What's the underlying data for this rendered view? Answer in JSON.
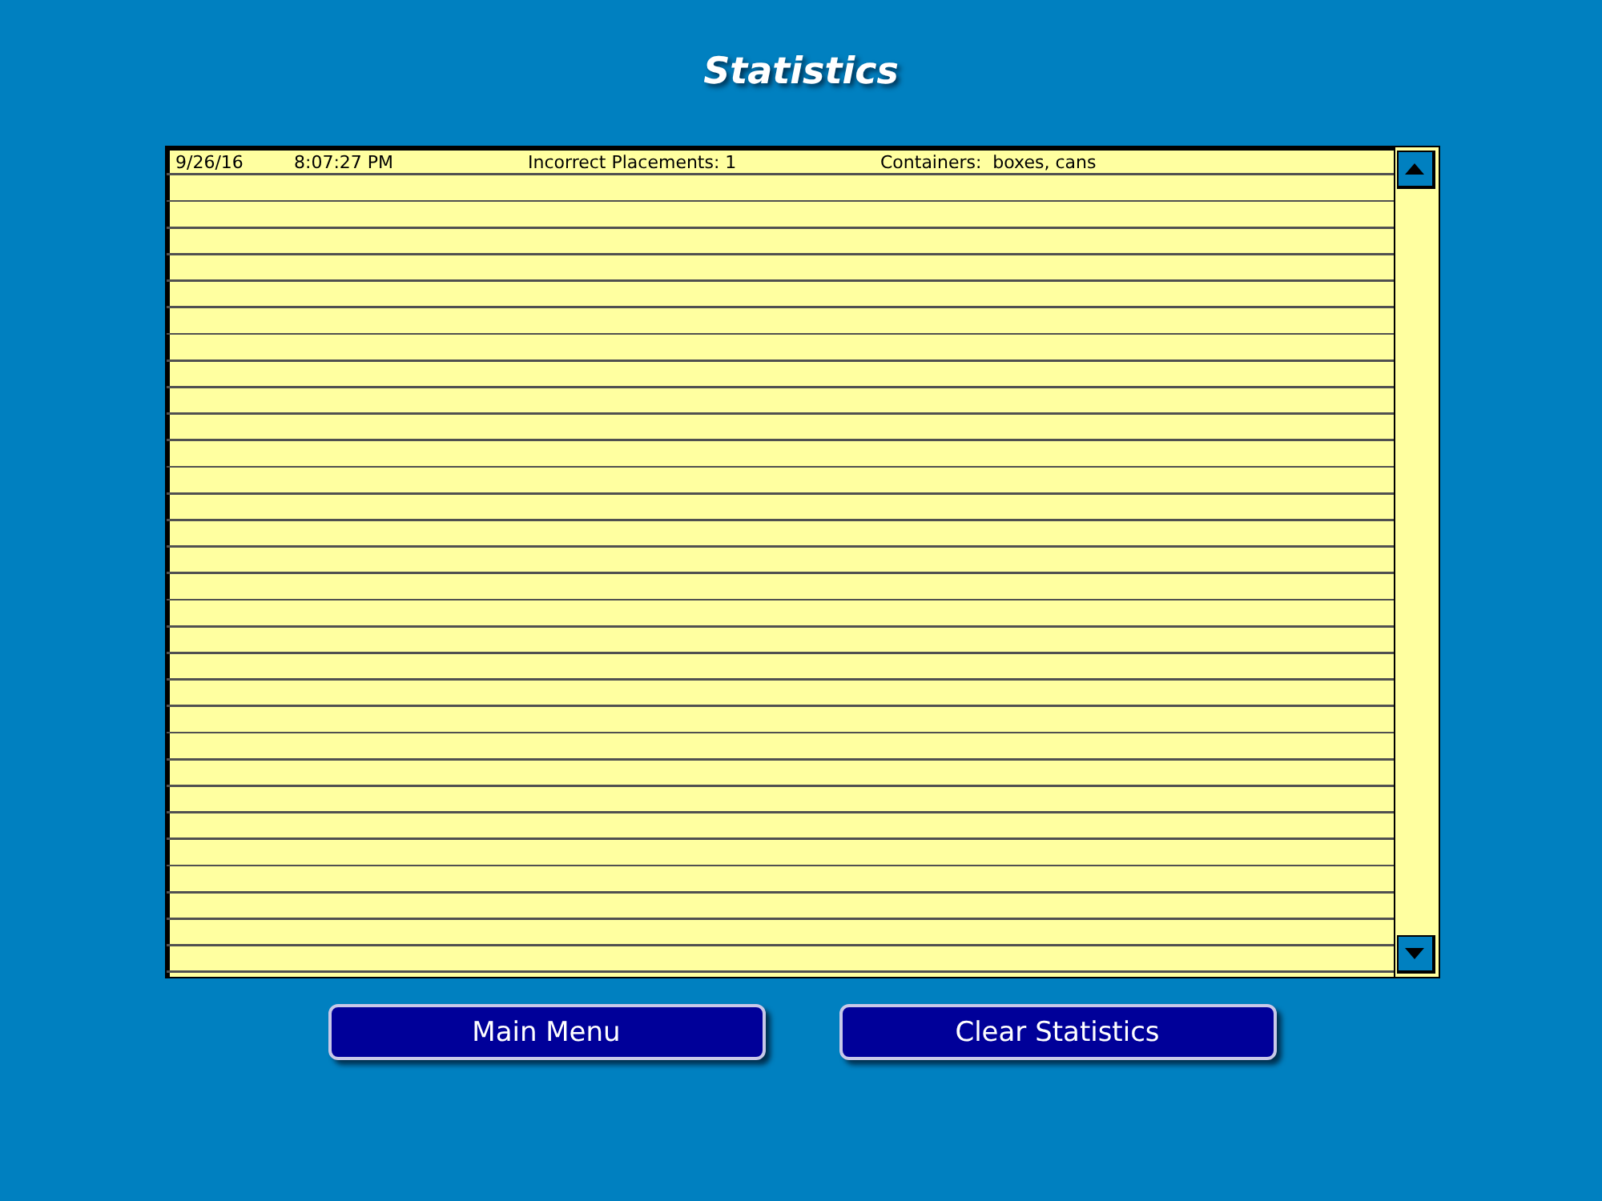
{
  "title": "Statistics",
  "records": [
    {
      "date": "9/26/16",
      "time": "8:07:27 PM",
      "placements": "Incorrect Placements: 1",
      "containers": "Containers:  boxes, cans"
    }
  ],
  "buttons": [
    "Main Menu",
    "Clear Statistics"
  ]
}
